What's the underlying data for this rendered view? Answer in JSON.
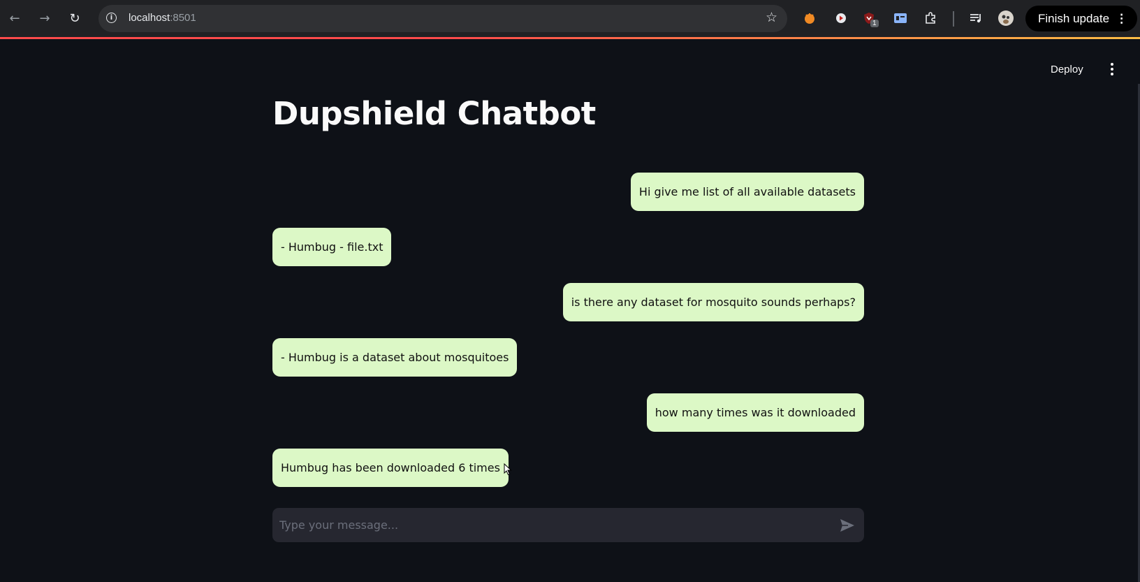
{
  "browser": {
    "url_host": "localhost",
    "url_port": ":8501",
    "finish_update_label": "Finish update",
    "extension_badge": "1",
    "icons": [
      "back-icon",
      "forward-icon",
      "reload-icon",
      "info-icon",
      "star-icon",
      "extensions-icon",
      "media-icon",
      "profile-icon",
      "more-icon"
    ]
  },
  "app": {
    "deploy_label": "Deploy",
    "title": "Dupshield Chatbot",
    "accent_color": "#ff4b4b",
    "bubble_color": "#dcf8c6",
    "background_color": "#0e1117"
  },
  "messages": [
    {
      "role": "user",
      "text": "Hi give me list of all available datasets"
    },
    {
      "role": "assistant",
      "text": "- Humbug - file.txt"
    },
    {
      "role": "user",
      "text": "is there any dataset for mosquito sounds perhaps?"
    },
    {
      "role": "assistant",
      "text": "- Humbug is a dataset about mosquitoes"
    },
    {
      "role": "user",
      "text": "how many times was it downloaded"
    },
    {
      "role": "assistant",
      "text": "Humbug has been downloaded 6 times"
    }
  ],
  "chat_input": {
    "placeholder": "Type your message...",
    "value": ""
  }
}
